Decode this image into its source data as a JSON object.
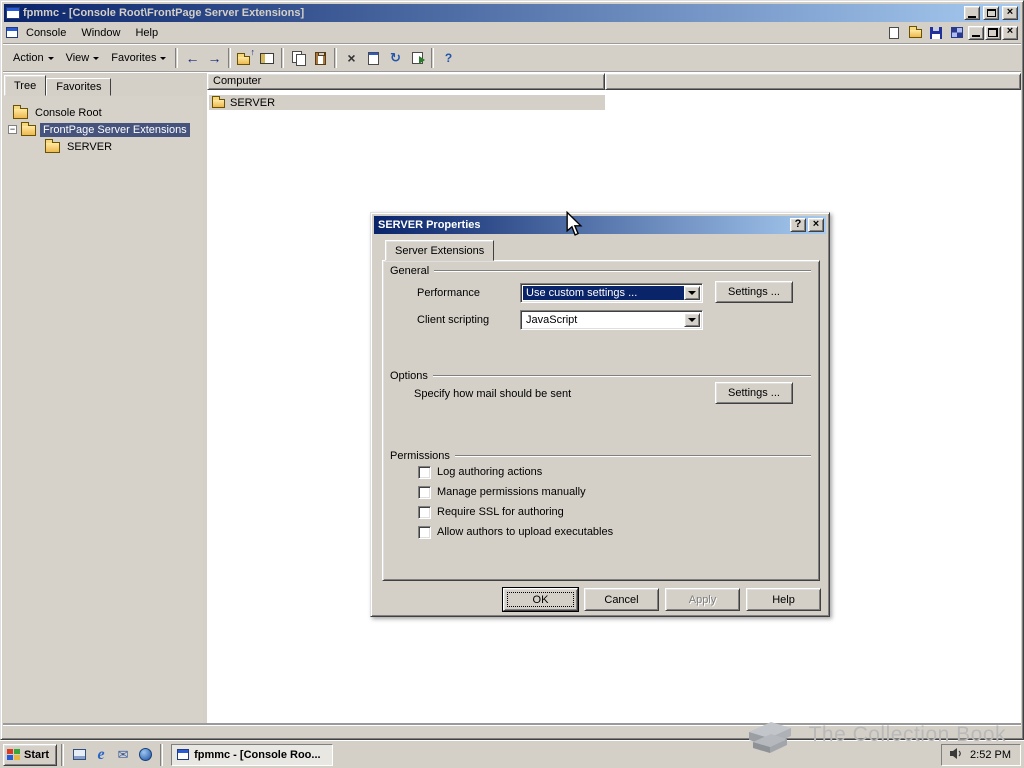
{
  "colors": {
    "window_face": "#d4d0c8",
    "pane_bg": "#d6d2ca",
    "titlebar_start": "#0a246a",
    "titlebar_end": "#a6caf0",
    "selection": "#0a246a",
    "tree_selection": "#45537d",
    "watermark": "#b9b9b9"
  },
  "icons": {
    "back": "←",
    "forward": "→",
    "up": "↑",
    "delete": "×",
    "refresh": "↻",
    "help": "?",
    "context_help": "?",
    "close": "×",
    "collapse": "−",
    "mail": "✉",
    "ie": "e"
  },
  "window": {
    "title": "fpmmc - [Console Root\\FrontPage Server Extensions]",
    "menus": [
      "Console",
      "Window",
      "Help"
    ],
    "toolbar_menus": [
      "Action",
      "View",
      "Favorites"
    ]
  },
  "left_pane": {
    "tabs": [
      "Tree",
      "Favorites"
    ],
    "tree": [
      {
        "label": "Console Root"
      },
      {
        "label": "FrontPage Server Extensions"
      },
      {
        "label": "SERVER"
      }
    ]
  },
  "right_pane": {
    "column_header": "Computer",
    "rows": [
      {
        "label": "SERVER"
      }
    ]
  },
  "dialog": {
    "title": "SERVER Properties",
    "tab": "Server Extensions",
    "general": {
      "heading": "General",
      "performance_label": "Performance",
      "performance_value": "Use custom settings ...",
      "client_scripting_label": "Client scripting",
      "client_scripting_value": "JavaScript",
      "settings_button": "Settings ..."
    },
    "options": {
      "heading": "Options",
      "mail_label": "Specify how mail should be sent",
      "settings_button": "Settings ..."
    },
    "permissions": {
      "heading": "Permissions",
      "items": [
        "Log authoring actions",
        "Manage permissions manually",
        "Require SSL for authoring",
        "Allow authors to upload executables"
      ]
    },
    "buttons": {
      "ok": "OK",
      "cancel": "Cancel",
      "apply": "Apply",
      "help": "Help"
    }
  },
  "taskbar": {
    "start_label": "Start",
    "task_label": "fpmmc - [Console Roo...",
    "clock": "2:52 PM"
  },
  "watermark_text": "The Collection Book"
}
